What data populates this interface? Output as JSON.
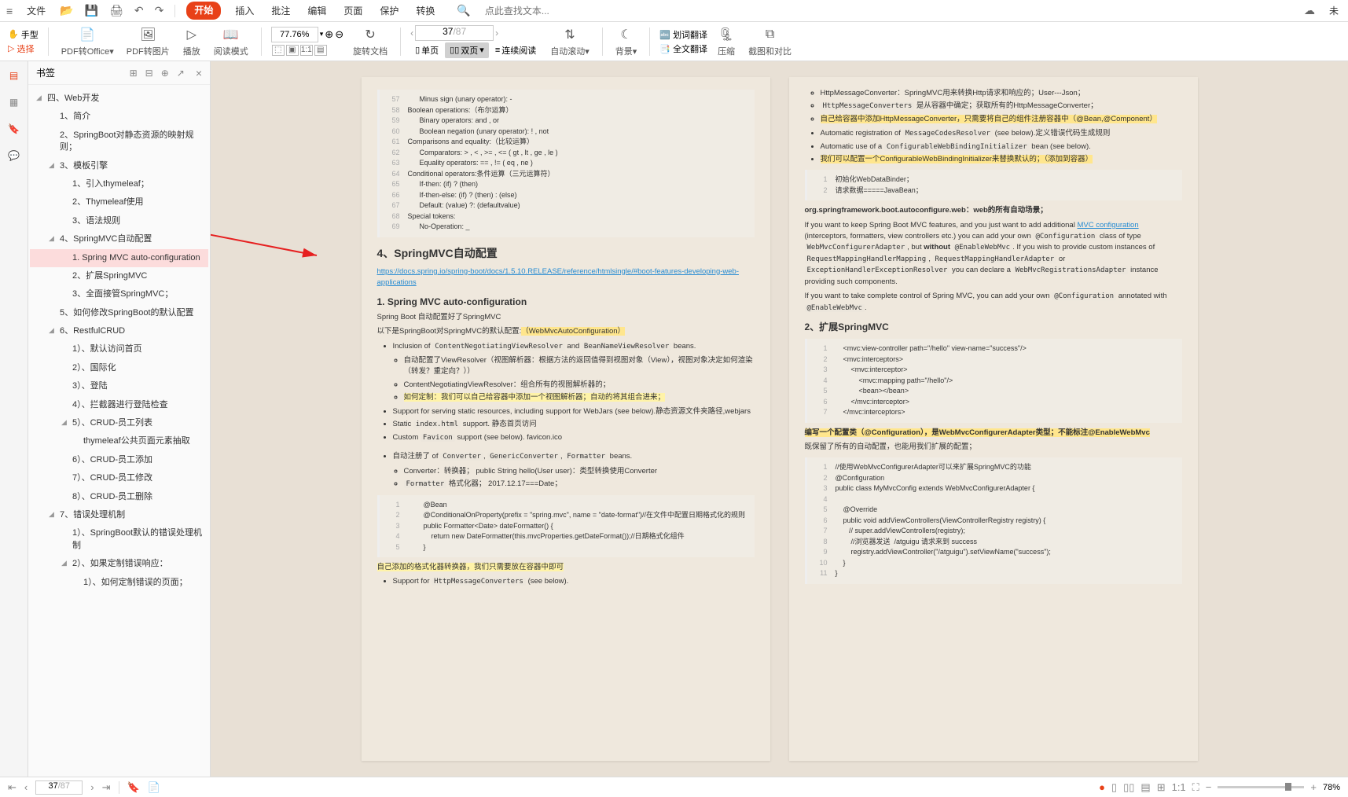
{
  "menubar": {
    "file": "文件",
    "items": [
      "开始",
      "插入",
      "批注",
      "编辑",
      "页面",
      "保护",
      "转换"
    ],
    "search_placeholder": "点此查找文本...",
    "right_label": "未"
  },
  "toolbar": {
    "hand": "手型",
    "select": "选择",
    "pdf_office": "PDF转Office",
    "pdf_image": "PDF转图片",
    "play": "播放",
    "read_mode": "阅读模式",
    "zoom": "77.76%",
    "rotate": "旋转文档",
    "single_page": "单页",
    "double_page": "双页",
    "continuous": "连续阅读",
    "auto_scroll": "自动滚动",
    "background": "背景",
    "word_trans": "划词翻译",
    "full_trans": "全文翻译",
    "compress": "压缩",
    "screenshot": "截图和对比",
    "page_current": "37",
    "page_total": "/87"
  },
  "bookmarks": {
    "title": "书签",
    "items": [
      {
        "t": "四、Web开发",
        "l": 1,
        "a": true
      },
      {
        "t": "1、简介",
        "l": 2
      },
      {
        "t": "2、SpringBoot对静态资源的映射规则；",
        "l": 2
      },
      {
        "t": "3、模板引擎",
        "l": 2,
        "a": true
      },
      {
        "t": "1、引入thymeleaf；",
        "l": 3
      },
      {
        "t": "2、Thymeleaf使用",
        "l": 3
      },
      {
        "t": "3、语法规则",
        "l": 3
      },
      {
        "t": "4、SpringMVC自动配置",
        "l": 2,
        "a": true
      },
      {
        "t": "1. Spring MVC auto-configuration",
        "l": 3,
        "hl": true
      },
      {
        "t": "2、扩展SpringMVC",
        "l": 3
      },
      {
        "t": "3、全面接管SpringMVC；",
        "l": 3
      },
      {
        "t": "5、如何修改SpringBoot的默认配置",
        "l": 2
      },
      {
        "t": "6、RestfulCRUD",
        "l": 2,
        "a": true
      },
      {
        "t": "1）、默认访问首页",
        "l": 3
      },
      {
        "t": "2）、国际化",
        "l": 3
      },
      {
        "t": "3）、登陆",
        "l": 3
      },
      {
        "t": "4）、拦截器进行登陆检查",
        "l": 3
      },
      {
        "t": "5）、CRUD-员工列表",
        "l": 3,
        "a": true
      },
      {
        "t": "thymeleaf公共页面元素抽取",
        "l": 3,
        "indent": true
      },
      {
        "t": "6）、CRUD-员工添加",
        "l": 3
      },
      {
        "t": "7）、CRUD-员工修改",
        "l": 3
      },
      {
        "t": "8）、CRUD-员工删除",
        "l": 3
      },
      {
        "t": "7、错误处理机制",
        "l": 2,
        "a": true
      },
      {
        "t": "1）、SpringBoot默认的错误处理机制",
        "l": 3
      },
      {
        "t": "2）、如果定制错误响应：",
        "l": 3,
        "a": true
      },
      {
        "t": "1）、如何定制错误的页面；",
        "l": 3,
        "indent": true
      }
    ]
  },
  "pageL": {
    "code1": [
      {
        "n": "57",
        "t": "      Minus sign (unary operator): -",
        "k": true
      },
      {
        "n": "58",
        "t": "Boolean operations:（布尔运算）",
        "k": true
      },
      {
        "n": "59",
        "t": "      Binary operators: and , or",
        "k": true
      },
      {
        "n": "60",
        "t": "      Boolean negation (unary operator): ! , not",
        "k": true
      },
      {
        "n": "61",
        "t": "Comparisons and equality:（比较运算）",
        "k": true
      },
      {
        "n": "62",
        "t": "      Comparators: > , < , >= , <= ( gt , lt , ge , le )",
        "k": true
      },
      {
        "n": "63",
        "t": "      Equality operators: == , != ( eq , ne )",
        "k": true
      },
      {
        "n": "64",
        "t": "Conditional operators:条件运算（三元运算符）",
        "k": true
      },
      {
        "n": "65",
        "t": "      If-then: (if) ? (then)",
        "k": true
      },
      {
        "n": "66",
        "t": "      If-then-else: (if) ? (then) : (else)",
        "k": true
      },
      {
        "n": "67",
        "t": "      Default: (value) ?: (defaultvalue)",
        "k": true
      },
      {
        "n": "68",
        "t": "Special tokens:",
        "k": true
      },
      {
        "n": "69",
        "t": "      No-Operation: _",
        "k": true
      }
    ],
    "h4": "4、SpringMVC自动配置",
    "link": "https://docs.spring.io/spring-boot/docs/1.5.10.RELEASE/reference/htmlsingle/#boot-features-developing-web-applications",
    "h5": "1. Spring MVC auto-configuration",
    "p1": "Spring Boot 自动配置好了SpringMVC",
    "p2a": "以下是SpringBoot对SpringMVC的默认配置:",
    "p2b": "（WebMvcAutoConfiguration）",
    "ul": [
      {
        "main": "Inclusion of ",
        "code1": "ContentNegotiatingViewResolver",
        "mid": " and ",
        "code2": "BeanNameViewResolver",
        "tail": " beans.",
        "sub": [
          "自动配置了ViewResolver（视图解析器：根据方法的返回值得到视图对象（View），视图对象决定如何渲染（转发？重定向？））",
          "ContentNegotiatingViewResolver：组合所有的视图解析器的；",
          {
            "hl": "如何定制：我们可以自己给容器中添加一个视图解析器；自动的将其组合进来；"
          }
        ]
      },
      {
        "main": "Support for serving static resources, including support for WebJars (see below).静态资源文件夹路径,webjars"
      },
      {
        "main": "Static ",
        "code1": "index.html",
        "tail": " support. 静态首页访问"
      },
      {
        "main": "Custom ",
        "code1": "Favicon",
        "tail": " support (see below). favicon.ico"
      }
    ],
    "ul2": [
      {
        "main": "自动注册了 of ",
        "codes": [
          "Converter",
          "GenericConverter",
          "Formatter"
        ],
        "tail": " beans.",
        "sub": [
          "Converter：转换器； public String hello(User user)：类型转换使用Converter",
          {
            "pre": "Formatter",
            "post": "  格式化器； 2017.12.17===Date；"
          }
        ]
      }
    ],
    "code2": [
      {
        "n": "1",
        "t": "        @Bean"
      },
      {
        "n": "2",
        "t": "        @ConditionalOnProperty(prefix = \"spring.mvc\", name = \"date-format\")//在文件中配置日期格式化的规则"
      },
      {
        "n": "3",
        "t": "        public Formatter<Date> dateFormatter() {"
      },
      {
        "n": "4",
        "t": "            return new DateFormatter(this.mvcProperties.getDateFormat());//日期格式化组件"
      },
      {
        "n": "5",
        "t": "        }"
      }
    ],
    "hl2": "自己添加的格式化器转换器，我们只需要放在容器中即可",
    "ul3": "Support for ",
    "ul3code": "HttpMessageConverters",
    "ul3tail": " (see below)."
  },
  "pageR": {
    "ul1": [
      {
        "t": "HttpMessageConverter：SpringMVC用来转换Http请求和响应的；User---Json；"
      },
      {
        "pre": "HttpMessageConverters",
        "post": " 是从容器中确定；获取所有的HttpMessageConverter；"
      },
      {
        "hl": "自己给容器中添加HttpMessageConverter，只需要将自己的组件注册容器中（@Bean,@Component）"
      }
    ],
    "ul2": [
      {
        "t": "Automatic registration of ",
        "code": "MessageCodesResolver",
        "tail": " (see below).定义错误代码生成规则"
      },
      {
        "t": "Automatic use of a ",
        "code": "ConfigurableWebBindingInitializer",
        "tail": " bean (see below)."
      },
      {
        "hl": "我们可以配置一个ConfigurableWebBindingInitializer来替换默认的；（添加到容器）"
      }
    ],
    "code1": [
      {
        "n": "1",
        "t": "初始化WebDataBinder；"
      },
      {
        "n": "2",
        "t": "请求数据=====JavaBean；"
      }
    ],
    "p1": "org.springframework.boot.autoconfigure.web：web的所有自动场景；",
    "p2a": "If you want to keep Spring Boot MVC features, and you just want to add additional ",
    "p2link": "MVC configuration",
    "p2b": " (interceptors, formatters, view controllers etc.) you can add your own ",
    "p2c1": "@Configuration",
    "p2c": " class of type ",
    "p2c2": "WebMvcConfigurerAdapter",
    "p2d": ", but ",
    "p2bold": "without",
    "p2e": " ",
    "p2c3": "@EnableWebMvc",
    "p2f": ". If you wish to provide custom instances of ",
    "p2c4": "RequestMappingHandlerMapping",
    "p2g": ", ",
    "p2c5": "RequestMappingHandlerAdapter",
    "p2h": " or ",
    "p2c6": "ExceptionHandlerExceptionResolver",
    "p2i": " you can declare a ",
    "p2c7": "WebMvcRegistrationsAdapter",
    "p2j": " instance providing such components.",
    "p3a": "If you want to take complete control of Spring MVC, you can add your own ",
    "p3c1": "@Configuration",
    "p3b": " annotated with ",
    "p3c2": "@EnableWebMvc",
    "p3c": ".",
    "h5": "2、扩展SpringMVC",
    "code2": [
      {
        "n": "1",
        "t": "    <mvc:view-controller path=\"/hello\" view-name=\"success\"/>"
      },
      {
        "n": "2",
        "t": "    <mvc:interceptors>"
      },
      {
        "n": "3",
        "t": "        <mvc:interceptor>"
      },
      {
        "n": "4",
        "t": "            <mvc:mapping path=\"/hello\"/>"
      },
      {
        "n": "5",
        "t": "            <bean></bean>"
      },
      {
        "n": "6",
        "t": "        </mvc:interceptor>"
      },
      {
        "n": "7",
        "t": "    </mvc:interceptors>"
      }
    ],
    "hl3": "编写一个配置类（@Configuration），是WebMvcConfigurerAdapter类型；不能标注@EnableWebMvc",
    "p4": "既保留了所有的自动配置，也能用我们扩展的配置；",
    "code3": [
      {
        "n": "1",
        "t": "//使用WebMvcConfigurerAdapter可以来扩展SpringMVC的功能"
      },
      {
        "n": "2",
        "t": "@Configuration"
      },
      {
        "n": "3",
        "t": "public class MyMvcConfig extends WebMvcConfigurerAdapter {"
      },
      {
        "n": "4",
        "t": ""
      },
      {
        "n": "5",
        "t": "    @Override"
      },
      {
        "n": "6",
        "t": "    public void addViewControllers(ViewControllerRegistry registry) {"
      },
      {
        "n": "7",
        "t": "       // super.addViewControllers(registry);"
      },
      {
        "n": "8",
        "t": "        //浏览器发送  /atguigu 请求来到 success"
      },
      {
        "n": "9",
        "t": "        registry.addViewController(\"/atguigu\").setViewName(\"success\");"
      },
      {
        "n": "10",
        "t": "    }"
      },
      {
        "n": "11",
        "t": "}"
      }
    ]
  },
  "statusbar": {
    "page": "37",
    "total": "/87",
    "zoom": "78%"
  }
}
